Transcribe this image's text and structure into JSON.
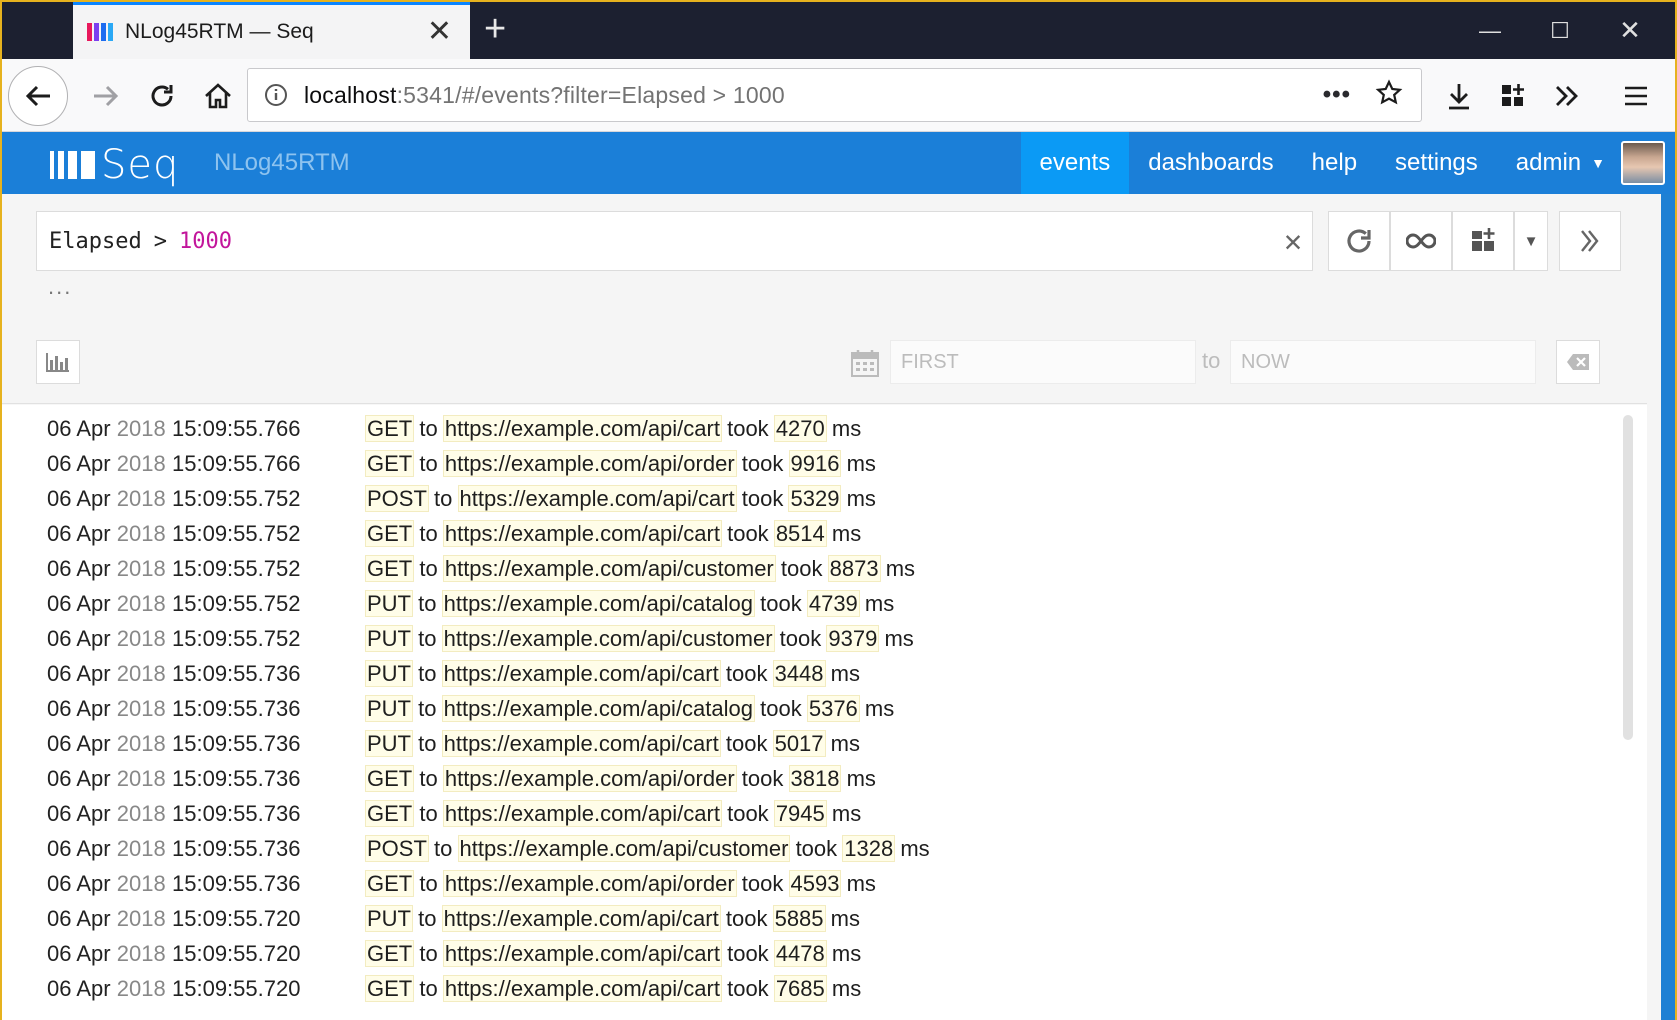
{
  "browser": {
    "tab_title": "NLog45RTM — Seq",
    "new_tab": "+",
    "url_host": "localhost",
    "url_rest": ":5341/#/events?filter=Elapsed > 1000",
    "url_dots": "•••",
    "favicon_colors": [
      "#e8185c",
      "#7c3ff0",
      "#1c6cf0",
      "#2aa8f5"
    ]
  },
  "seq": {
    "logo": "Seq",
    "instance": "NLog45RTM",
    "nav": [
      "events",
      "dashboards",
      "help",
      "settings",
      "admin"
    ],
    "active_nav": "events",
    "accent": "#1b7fd8"
  },
  "filter": {
    "field": "Elapsed",
    "operator": ">",
    "value": "1000",
    "more": "...",
    "range_from_placeholder": "FIRST",
    "range_to_label": "to",
    "range_to_placeholder": "NOW"
  },
  "events": [
    {
      "day": "06 Apr",
      "year": "2018",
      "time": "15:09:55.766",
      "method": "GET",
      "url": "https://example.com/api/cart",
      "elapsed": "4270"
    },
    {
      "day": "06 Apr",
      "year": "2018",
      "time": "15:09:55.766",
      "method": "GET",
      "url": "https://example.com/api/order",
      "elapsed": "9916"
    },
    {
      "day": "06 Apr",
      "year": "2018",
      "time": "15:09:55.752",
      "method": "POST",
      "url": "https://example.com/api/cart",
      "elapsed": "5329"
    },
    {
      "day": "06 Apr",
      "year": "2018",
      "time": "15:09:55.752",
      "method": "GET",
      "url": "https://example.com/api/cart",
      "elapsed": "8514"
    },
    {
      "day": "06 Apr",
      "year": "2018",
      "time": "15:09:55.752",
      "method": "GET",
      "url": "https://example.com/api/customer",
      "elapsed": "8873"
    },
    {
      "day": "06 Apr",
      "year": "2018",
      "time": "15:09:55.752",
      "method": "PUT",
      "url": "https://example.com/api/catalog",
      "elapsed": "4739"
    },
    {
      "day": "06 Apr",
      "year": "2018",
      "time": "15:09:55.752",
      "method": "PUT",
      "url": "https://example.com/api/customer",
      "elapsed": "9379"
    },
    {
      "day": "06 Apr",
      "year": "2018",
      "time": "15:09:55.736",
      "method": "PUT",
      "url": "https://example.com/api/cart",
      "elapsed": "3448"
    },
    {
      "day": "06 Apr",
      "year": "2018",
      "time": "15:09:55.736",
      "method": "PUT",
      "url": "https://example.com/api/catalog",
      "elapsed": "5376"
    },
    {
      "day": "06 Apr",
      "year": "2018",
      "time": "15:09:55.736",
      "method": "PUT",
      "url": "https://example.com/api/cart",
      "elapsed": "5017"
    },
    {
      "day": "06 Apr",
      "year": "2018",
      "time": "15:09:55.736",
      "method": "GET",
      "url": "https://example.com/api/order",
      "elapsed": "3818"
    },
    {
      "day": "06 Apr",
      "year": "2018",
      "time": "15:09:55.736",
      "method": "GET",
      "url": "https://example.com/api/cart",
      "elapsed": "7945"
    },
    {
      "day": "06 Apr",
      "year": "2018",
      "time": "15:09:55.736",
      "method": "POST",
      "url": "https://example.com/api/customer",
      "elapsed": "1328"
    },
    {
      "day": "06 Apr",
      "year": "2018",
      "time": "15:09:55.736",
      "method": "GET",
      "url": "https://example.com/api/order",
      "elapsed": "4593"
    },
    {
      "day": "06 Apr",
      "year": "2018",
      "time": "15:09:55.720",
      "method": "PUT",
      "url": "https://example.com/api/cart",
      "elapsed": "5885"
    },
    {
      "day": "06 Apr",
      "year": "2018",
      "time": "15:09:55.720",
      "method": "GET",
      "url": "https://example.com/api/cart",
      "elapsed": "4478"
    },
    {
      "day": "06 Apr",
      "year": "2018",
      "time": "15:09:55.720",
      "method": "GET",
      "url": "https://example.com/api/cart",
      "elapsed": "7685"
    }
  ],
  "words": {
    "to": "to",
    "took": "took",
    "ms": "ms"
  }
}
